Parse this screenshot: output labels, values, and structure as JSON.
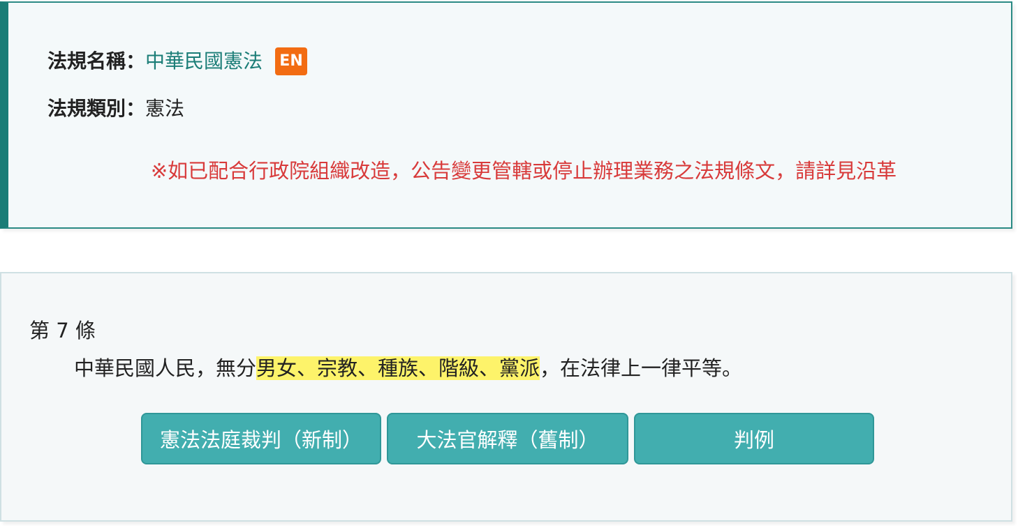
{
  "law_info": {
    "name_label": "法規名稱：",
    "name_value": "中華民國憲法",
    "en_badge": "EN",
    "category_label": "法規類別：",
    "category_value": "憲法",
    "notice": "※如已配合行政院組織改造，公告變更管轄或停止辦理業務之法規條文，請詳見沿革"
  },
  "article": {
    "number": "第 7 條",
    "text_before": "中華民國人民，無分",
    "text_highlight": "男女、宗教、種族、階級、黨派",
    "text_after": "，在法律上一律平等。",
    "buttons": [
      {
        "label": "憲法法庭裁判（新制）"
      },
      {
        "label": "大法官解釋（舊制）"
      },
      {
        "label": "判例"
      }
    ]
  },
  "colors": {
    "accent_teal": "#1b7d77",
    "button_teal": "#42aeaf",
    "en_badge_orange": "#f26c12",
    "notice_red": "#d83a3a",
    "highlight_yellow": "#fdf36a"
  }
}
